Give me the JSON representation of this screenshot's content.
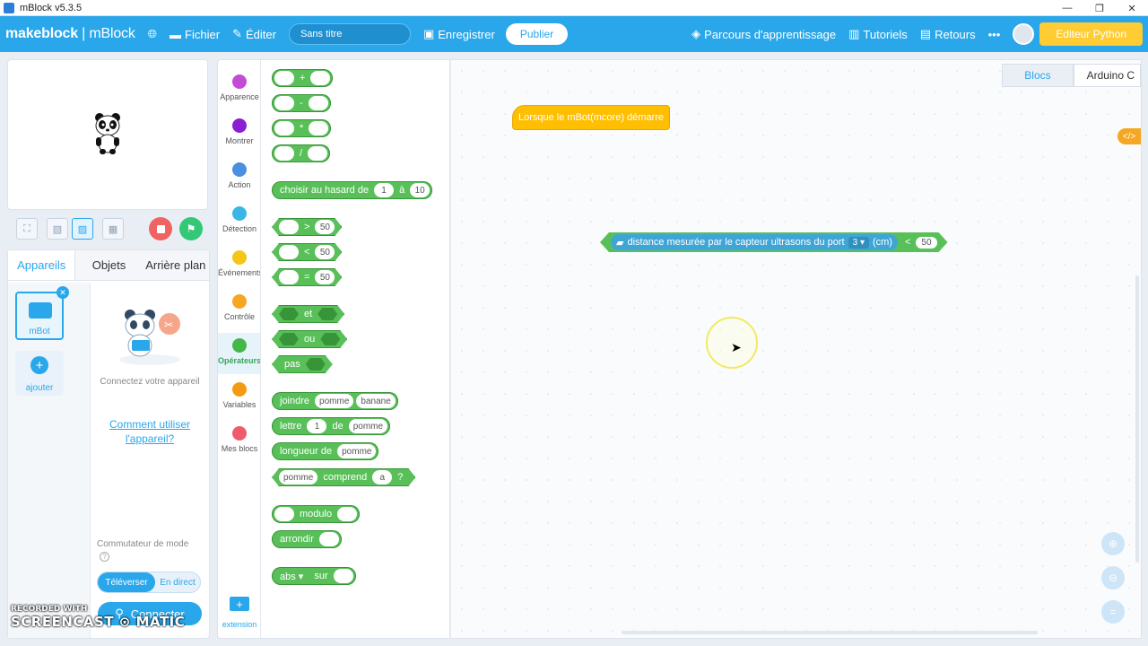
{
  "window": {
    "title": "mBlock v5.3.5",
    "controls": [
      "—",
      "❐",
      "✕"
    ]
  },
  "menubar": {
    "brand_main": "makeblock",
    "brand_product": "| mBlock",
    "file": "Fichier",
    "edit": "Éditer",
    "project_title": "Sans titre",
    "save": "Enregistrer",
    "publish": "Publier",
    "learning": "Parcours d'apprentissage",
    "tutorials": "Tutoriels",
    "feedback": "Retours",
    "more": "•••",
    "python_editor": "Editeur Python"
  },
  "device_panel": {
    "tabs": [
      "Appareils",
      "Objets",
      "Arrière plan"
    ],
    "device_name": "mBot",
    "add_label": "ajouter",
    "connect_prompt": "Connectez votre appareil",
    "howto_link": "Comment utiliser l'appareil?",
    "mode_switch_label": "Commutateur de mode",
    "mode_upload": "Téléverser",
    "mode_live": "En direct",
    "connect_button": "Connecter"
  },
  "categories": [
    {
      "label": "Apparence",
      "color": "#c34bd6"
    },
    {
      "label": "Montrer",
      "color": "#8a1fd1"
    },
    {
      "label": "Action",
      "color": "#4a8fe0"
    },
    {
      "label": "Détection",
      "color": "#3ab6e6"
    },
    {
      "label": "Événements",
      "color": "#f5c518"
    },
    {
      "label": "Contrôle",
      "color": "#f5a623"
    },
    {
      "label": "Opérateurs",
      "color": "#45b649"
    },
    {
      "label": "Variables",
      "color": "#f39c12"
    },
    {
      "label": "Mes blocs",
      "color": "#ef5a6f"
    }
  ],
  "extension_label": "extension",
  "palette": {
    "plus": "+",
    "minus": "-",
    "times": "*",
    "divide": "/",
    "random": "choisir au hasard de",
    "random_from": "1",
    "random_to_word": "à",
    "random_to": "10",
    "gt": ">",
    "lt": "<",
    "eq": "=",
    "cmp_value": "50",
    "and": "et",
    "or": "ou",
    "not": "pas",
    "join": "joindre",
    "join_a": "pomme",
    "join_b": "banane",
    "letter": "lettre",
    "letter_n": "1",
    "letter_of": "de",
    "letter_word": "pomme",
    "length": "longueur de",
    "length_word": "pomme",
    "contains_word": "pomme",
    "contains": "comprend",
    "contains_a": "a",
    "contains_q": "?",
    "modulo": "modulo",
    "round": "arrondir",
    "abs": "abs ▾",
    "abs_of": "sur"
  },
  "workspace": {
    "tab_blocks": "Blocs",
    "tab_arduino": "Arduino C",
    "code_toggle": "</>",
    "hat_block": "Lorsque le mBot(mcore) démarre",
    "sensor_text": "distance mesurée par le capteur ultrasons du port",
    "sensor_port": "3 ▾",
    "sensor_unit": "(cm)",
    "compare_op": "<",
    "compare_value": "50"
  },
  "watermark": {
    "line1": "RECORDED WITH",
    "line2": "SCREENCAST ⊙ MATIC"
  }
}
